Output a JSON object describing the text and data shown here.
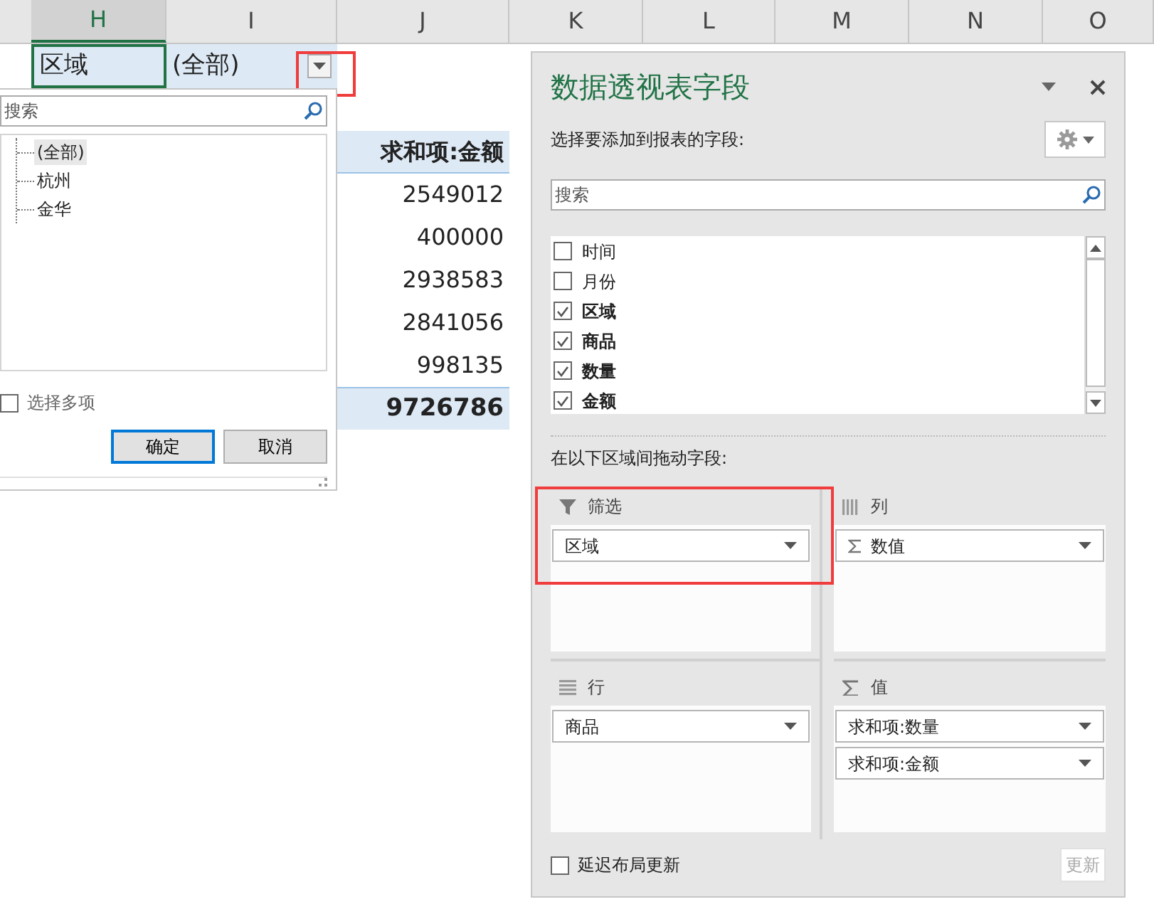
{
  "column_headers": [
    {
      "label": "H",
      "selected": true
    },
    {
      "label": "I",
      "selected": false
    },
    {
      "label": "J",
      "selected": false
    },
    {
      "label": "K",
      "selected": false
    },
    {
      "label": "L",
      "selected": false
    },
    {
      "label": "M",
      "selected": false
    },
    {
      "label": "N",
      "selected": false
    },
    {
      "label": "O",
      "selected": false
    }
  ],
  "filter_cell": {
    "label": "区域",
    "value": "(全部)",
    "dropdown_highlighted": true
  },
  "filter_dropdown": {
    "search_placeholder": "搜索",
    "items": [
      {
        "label": "(全部)",
        "selected": true
      },
      {
        "label": "杭州",
        "selected": false
      },
      {
        "label": "金华",
        "selected": false
      }
    ],
    "select_multiple": {
      "label": "选择多项",
      "checked": false
    },
    "buttons": [
      {
        "label": "确定",
        "focused": true
      },
      {
        "label": "取消",
        "focused": false
      }
    ]
  },
  "pivot_table": {
    "header": "求和项:金额",
    "values": [
      "2549012",
      "400000",
      "2938583",
      "2841056",
      "998135"
    ],
    "total": "9726786"
  },
  "field_pane": {
    "title": "数据透视表字段",
    "subtitle": "选择要添加到报表的字段:",
    "search_placeholder": "搜索",
    "fields": [
      {
        "label": "时间",
        "checked": false
      },
      {
        "label": "月份",
        "checked": false
      },
      {
        "label": "区域",
        "checked": true
      },
      {
        "label": "商品",
        "checked": true
      },
      {
        "label": "数量",
        "checked": true
      },
      {
        "label": "金额",
        "checked": true
      }
    ],
    "drag_label": "在以下区域间拖动字段:",
    "areas": [
      {
        "kind": "filter",
        "label": "筛选",
        "highlighted": true,
        "items": [
          {
            "label": "区域",
            "kind": "field"
          }
        ]
      },
      {
        "kind": "columns",
        "label": "列",
        "highlighted": false,
        "items": [
          {
            "label": "数值",
            "kind": "values"
          }
        ]
      },
      {
        "kind": "rows",
        "label": "行",
        "highlighted": false,
        "items": [
          {
            "label": "商品",
            "kind": "field"
          }
        ]
      },
      {
        "kind": "values",
        "label": "值",
        "highlighted": false,
        "items": [
          {
            "label": "求和项:数量",
            "kind": "field"
          },
          {
            "label": "求和项:金额",
            "kind": "field"
          }
        ]
      }
    ],
    "defer_update": {
      "label": "延迟布局更新",
      "checked": false
    },
    "update_button": {
      "label": "更新",
      "disabled": true
    }
  }
}
